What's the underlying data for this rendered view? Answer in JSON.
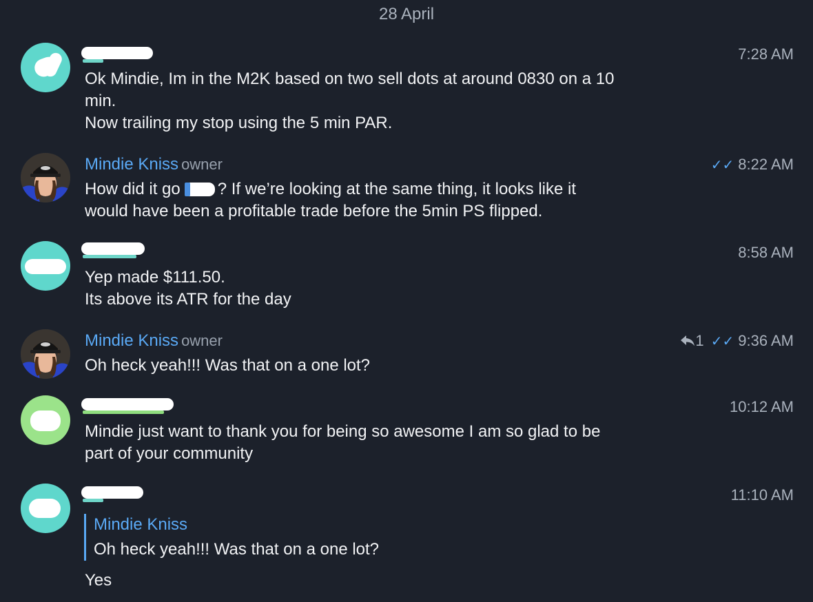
{
  "date_separator": "28 April",
  "messages": [
    {
      "sender": "",
      "time": "7:28 AM",
      "lines": [
        "Ok Mindie, Im in the M2K based on two sell dots at around 0830 on a 10",
        "min.",
        "Now trailing my stop using the 5 min PAR."
      ]
    },
    {
      "sender": "Mindie Kniss",
      "role": "owner",
      "time": "8:22 AM",
      "ticks": "✓✓",
      "line1_before": "How did it go",
      "line1_after": "? If we’re looking at the same thing, it looks like it",
      "line2": "would have been a profitable trade before the 5min PS flipped."
    },
    {
      "sender": "",
      "time": "8:58 AM",
      "lines": [
        "Yep made $111.50.",
        "Its above its ATR for the day"
      ]
    },
    {
      "sender": "Mindie Kniss",
      "role": "owner",
      "time": "9:36 AM",
      "reply_count": "1",
      "ticks": "✓✓",
      "lines": [
        "Oh heck yeah!!! Was that on a one lot?"
      ]
    },
    {
      "sender": "",
      "time": "10:12 AM",
      "lines": [
        "Mindie just want to thank you for being so awesome I am so glad to be",
        "part of your community"
      ]
    },
    {
      "sender": "",
      "time": "11:10 AM",
      "quote": {
        "name": "Mindie Kniss",
        "text": "Oh heck yeah!!! Was that on a one lot?"
      },
      "lines": [
        "Yes"
      ]
    }
  ],
  "colors": {
    "background": "#1c212b",
    "accent": "#5aa9f5",
    "muted": "#aab2bd",
    "avatar_teal": "#5fd7cc",
    "avatar_green": "#9be38a"
  },
  "icons": {
    "read_receipt": "double-check-icon",
    "reply": "reply-arrow-icon"
  }
}
